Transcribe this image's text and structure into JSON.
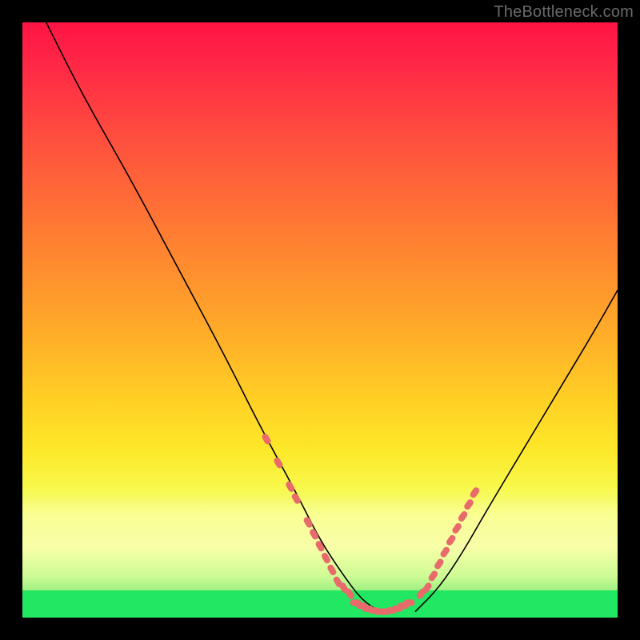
{
  "watermark": "TheBottleneck.com",
  "chart_data": {
    "type": "line",
    "title": "",
    "xlabel": "",
    "ylabel": "",
    "xlim": [
      0,
      100
    ],
    "ylim": [
      0,
      100
    ],
    "grid": false,
    "legend": false,
    "series": [
      {
        "name": "left-curve",
        "x": [
          4,
          10,
          18,
          26,
          34,
          40,
          46,
          50,
          54,
          57,
          60
        ],
        "values": [
          100,
          88,
          74,
          59,
          44,
          32,
          21,
          13,
          7,
          3,
          1
        ]
      },
      {
        "name": "right-curve",
        "x": [
          66,
          70,
          74,
          78,
          84,
          90,
          96,
          100
        ],
        "values": [
          1,
          5,
          11,
          18,
          28,
          38,
          48,
          55
        ]
      },
      {
        "name": "marker-band-left",
        "kind": "scatter",
        "x": [
          41,
          43,
          45,
          46,
          48,
          49,
          50,
          51,
          52,
          53,
          54,
          55
        ],
        "values": [
          30,
          26,
          22,
          20,
          16,
          14,
          12,
          10,
          8,
          6,
          5,
          4
        ]
      },
      {
        "name": "marker-band-bottom",
        "kind": "scatter",
        "x": [
          56,
          57,
          58,
          59,
          60,
          61,
          62,
          63,
          64,
          65
        ],
        "values": [
          2.5,
          2,
          1.5,
          1.2,
          1,
          1,
          1.2,
          1.5,
          2,
          2.5
        ]
      },
      {
        "name": "marker-band-right",
        "kind": "scatter",
        "x": [
          67,
          68,
          69,
          70,
          71,
          72,
          73,
          74,
          75,
          76
        ],
        "values": [
          4,
          5,
          7,
          9,
          11,
          13,
          15,
          17,
          19,
          21
        ]
      }
    ],
    "annotations": []
  }
}
